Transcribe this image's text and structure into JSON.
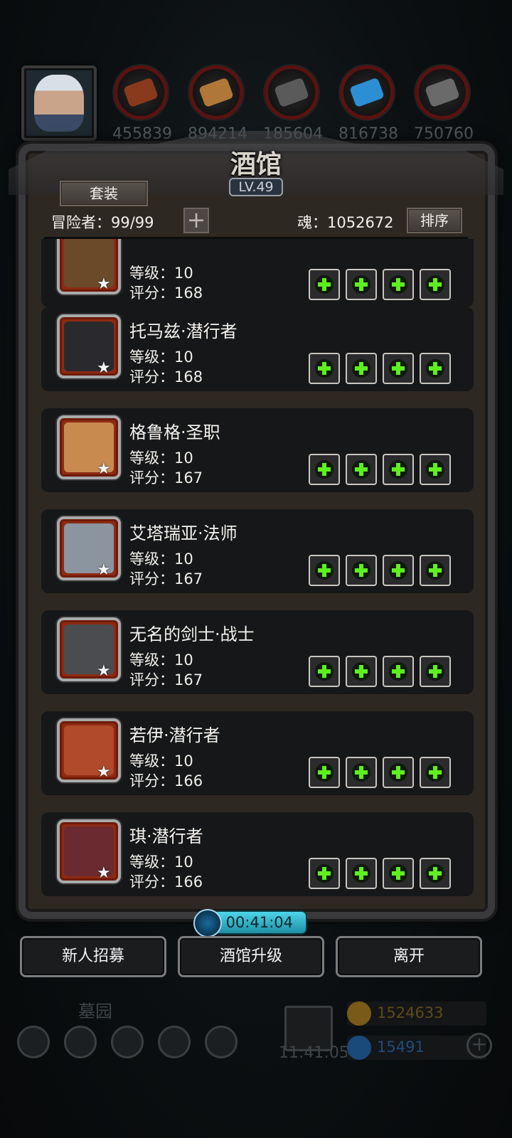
{
  "resources": [
    {
      "icon": "meat-icon",
      "value": "455839",
      "color": "#8a3a1c"
    },
    {
      "icon": "wood-icon",
      "value": "894214",
      "color": "#b07838"
    },
    {
      "icon": "iron-icon",
      "value": "185604",
      "color": "#5a5a5a"
    },
    {
      "icon": "crystal-icon",
      "value": "816738",
      "color": "#2c8fd4"
    },
    {
      "icon": "steel-icon",
      "value": "750760",
      "color": "#6a6a6a"
    }
  ],
  "panel": {
    "title": "酒馆",
    "level": "LV.49",
    "set_button": "套装",
    "adventurers": "冒险者：99/99",
    "soul": "魂：1052672",
    "sort_button": "排序"
  },
  "heroes": [
    {
      "name": "",
      "level": "等级：10",
      "score": "评分：168",
      "portrait": "dwarf",
      "tint": "#6b4a2a"
    },
    {
      "name": "托马兹·潜行者",
      "level": "等级：10",
      "score": "评分：168",
      "portrait": "masked-rogue",
      "tint": "#2a2a2e"
    },
    {
      "name": "格鲁格·圣职",
      "level": "等级：10",
      "score": "评分：167",
      "portrait": "priest",
      "tint": "#c98a50"
    },
    {
      "name": "艾塔瑞亚·法师",
      "level": "等级：10",
      "score": "评分：167",
      "portrait": "mage",
      "tint": "#8c94a0"
    },
    {
      "name": "无名的剑士·战士",
      "level": "等级：10",
      "score": "评分：167",
      "portrait": "knight",
      "tint": "#4a4c50"
    },
    {
      "name": "若伊·潜行者",
      "level": "等级：10",
      "score": "评分：166",
      "portrait": "red-hood",
      "tint": "#b04a2a"
    },
    {
      "name": "琪·潜行者",
      "level": "等级：10",
      "score": "评分：166",
      "portrait": "hat-rogue",
      "tint": "#6a2a30"
    }
  ],
  "timer": "00:41:04",
  "actions": {
    "recruit": "新人招募",
    "upgrade": "酒馆升级",
    "leave": "离开"
  },
  "bottom": {
    "label": "墓园",
    "time": "11:41:05",
    "gold": "1524633",
    "gems": "15491",
    "gold_color": "#c8a030",
    "gem_color": "#2a8ad4"
  }
}
